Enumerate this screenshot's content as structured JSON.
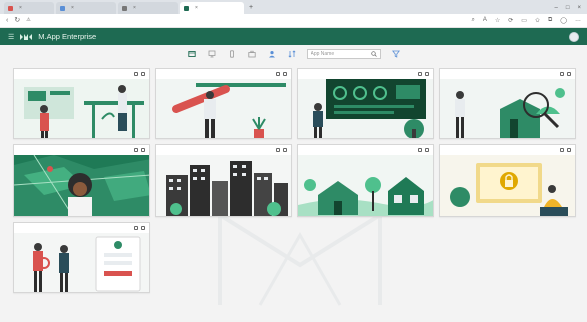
{
  "browser": {
    "tabs": [
      {
        "title": ""
      },
      {
        "title": ""
      },
      {
        "title": ""
      },
      {
        "title": "",
        "active": true
      }
    ],
    "new_tab": "+",
    "url": ""
  },
  "app": {
    "title": "M.App Enterprise",
    "accent": "#1e6a52"
  },
  "toolbar": {
    "search_placeholder": "App Name",
    "icons": [
      "tablet-icon",
      "monitor-icon",
      "phone-icon",
      "briefcase-icon",
      "person-icon",
      "sort-icon",
      "filter-icon"
    ]
  },
  "cards": [
    {
      "title": ""
    },
    {
      "title": ""
    },
    {
      "title": ""
    },
    {
      "title": ""
    },
    {
      "title": ""
    },
    {
      "title": ""
    },
    {
      "title": ""
    },
    {
      "title": ""
    },
    {
      "title": ""
    }
  ]
}
